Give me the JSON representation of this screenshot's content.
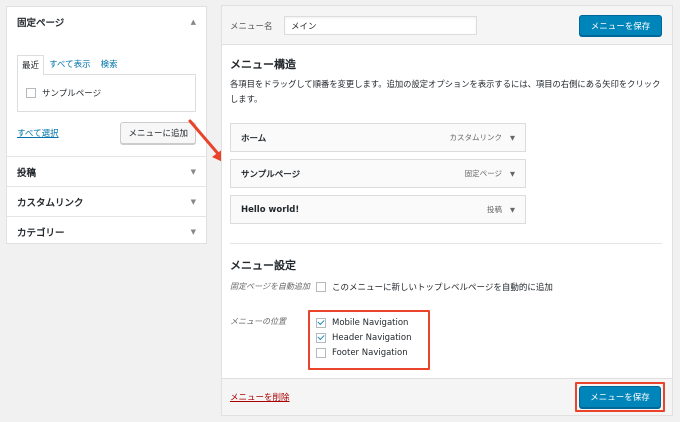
{
  "left": {
    "pages_box": {
      "title": "固定ページ",
      "tabs": [
        "最近",
        "すべて表示",
        "検索"
      ],
      "item_label": "サンプルページ",
      "select_all": "すべて選択",
      "add_button": "メニューに追加"
    },
    "sections": [
      "投稿",
      "カスタムリンク",
      "カテゴリー"
    ]
  },
  "main": {
    "name_label": "メニュー名",
    "name_value": "メイン",
    "save_button": "メニューを保存",
    "structure_title": "メニュー構造",
    "structure_desc": "各項目をドラッグして順番を変更します。追加の設定オプションを表示するには、項目の右側にある矢印をクリックします。",
    "items": [
      {
        "title": "ホーム",
        "type": "カスタムリンク"
      },
      {
        "title": "サンプルページ",
        "type": "固定ページ"
      },
      {
        "title": "Hello world!",
        "type": "投稿"
      }
    ],
    "settings_title": "メニュー設定",
    "auto_add_label": "固定ページを自動追加",
    "auto_add_option": "このメニューに新しいトップレベルページを自動的に追加",
    "location_label": "メニューの位置",
    "locations": [
      {
        "label": "Mobile Navigation",
        "checked": true
      },
      {
        "label": "Header Navigation",
        "checked": true
      },
      {
        "label": "Footer Navigation",
        "checked": false
      }
    ],
    "delete_link": "メニューを削除"
  },
  "colors": {
    "primary": "#0085ba",
    "highlight": "#e9432b",
    "link": "#0073aa",
    "delete": "#aa0000"
  }
}
